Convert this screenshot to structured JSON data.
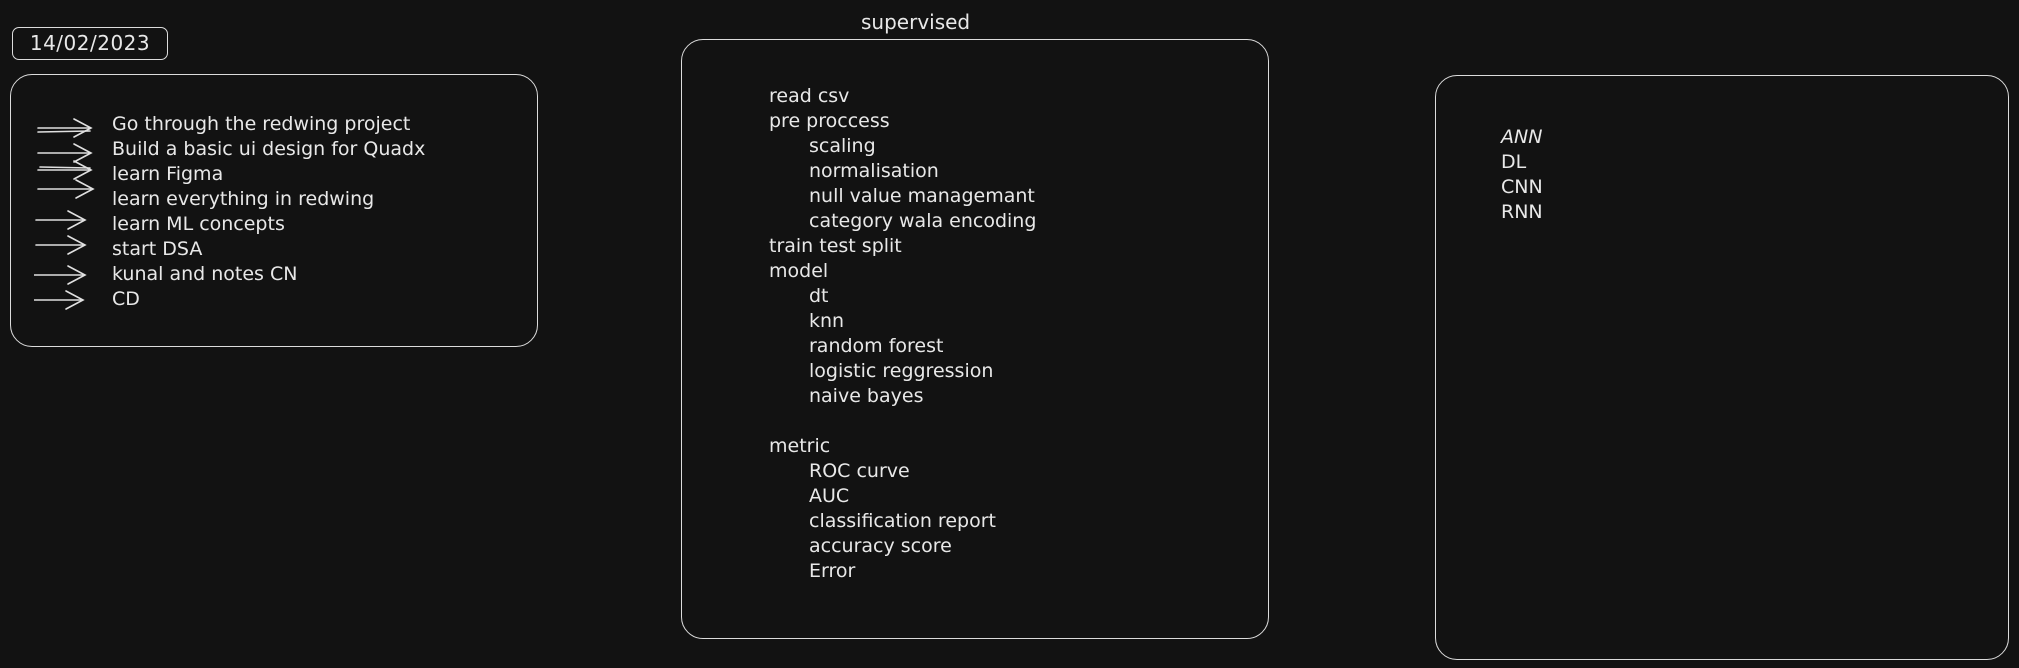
{
  "date": "14/02/2023",
  "todo": {
    "items": [
      "Go through the redwing project",
      "Build a basic ui design for Quadx",
      "learn Figma",
      "learn everything in redwing",
      "learn ML concepts",
      "start DSA",
      "kunal and notes CN",
      "CD"
    ]
  },
  "supervised": {
    "title": "supervised",
    "items": [
      {
        "text": "read csv",
        "indent": false
      },
      {
        "text": "pre proccess",
        "indent": false
      },
      {
        "text": "scaling",
        "indent": true
      },
      {
        "text": "normalisation",
        "indent": true
      },
      {
        "text": "null value managemant",
        "indent": true
      },
      {
        "text": "category wala encoding",
        "indent": true
      },
      {
        "text": "train test split",
        "indent": false
      },
      {
        "text": "model",
        "indent": false
      },
      {
        "text": "dt",
        "indent": true
      },
      {
        "text": "knn",
        "indent": true
      },
      {
        "text": "random forest",
        "indent": true
      },
      {
        "text": "logistic reggression",
        "indent": true
      },
      {
        "text": "naive bayes",
        "indent": true
      },
      {
        "text": "",
        "indent": false
      },
      {
        "text": "metric",
        "indent": false
      },
      {
        "text": "ROC curve",
        "indent": true
      },
      {
        "text": "AUC",
        "indent": true
      },
      {
        "text": "classification report",
        "indent": true
      },
      {
        "text": "accuracy score",
        "indent": true
      },
      {
        "text": "Error",
        "indent": true
      }
    ]
  },
  "deep": {
    "items": [
      "ANN",
      "DL",
      "CNN",
      "RNN"
    ]
  }
}
